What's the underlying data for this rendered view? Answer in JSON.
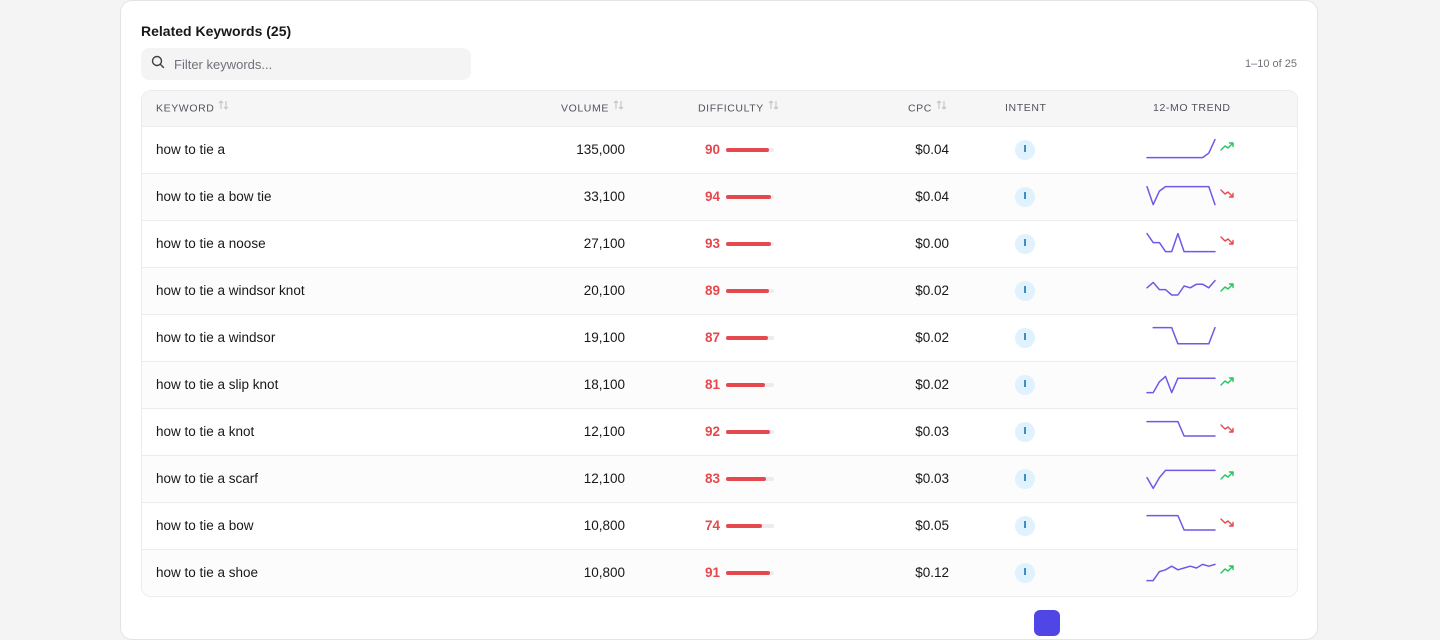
{
  "title": "Related Keywords (25)",
  "search": {
    "placeholder": "Filter keywords..."
  },
  "range_text": "1–10 of 25",
  "columns": {
    "keyword": "KEYWORD",
    "volume": "VOLUME",
    "difficulty": "DIFFICULTY",
    "cpc": "CPC",
    "intent": "INTENT",
    "trend": "12-MO TREND"
  },
  "colors": {
    "difficulty": "#e5484d",
    "sparkline": "#6d5ae6",
    "trend_up": "#22c55e",
    "trend_down": "#e5484d",
    "intent_bg": "#e0f2fe",
    "pager_active": "#4f46e5"
  },
  "rows": [
    {
      "keyword": "how to tie a",
      "volume": "135,000",
      "difficulty": "90",
      "cpc": "$0.04",
      "intent": "I",
      "trend_direction": "up",
      "trend": [
        40,
        40,
        40,
        40,
        40,
        40,
        40,
        40,
        40,
        40,
        35,
        20
      ]
    },
    {
      "keyword": "how to tie a bow tie",
      "volume": "33,100",
      "difficulty": "94",
      "cpc": "$0.04",
      "intent": "I",
      "trend_direction": "down",
      "trend": [
        20,
        40,
        25,
        20,
        20,
        20,
        20,
        20,
        20,
        20,
        20,
        40
      ]
    },
    {
      "keyword": "how to tie a noose",
      "volume": "27,100",
      "difficulty": "93",
      "cpc": "$0.00",
      "intent": "I",
      "trend_direction": "down",
      "trend": [
        20,
        30,
        30,
        40,
        40,
        20,
        40,
        40,
        40,
        40,
        40,
        40
      ]
    },
    {
      "keyword": "how to tie a windsor knot",
      "volume": "20,100",
      "difficulty": "89",
      "cpc": "$0.02",
      "intent": "I",
      "trend_direction": "up",
      "trend": [
        28,
        22,
        30,
        30,
        36,
        36,
        26,
        28,
        24,
        24,
        28,
        20
      ]
    },
    {
      "keyword": "how to tie a windsor",
      "volume": "19,100",
      "difficulty": "87",
      "cpc": "$0.02",
      "intent": "I",
      "trend_direction": "",
      "trend": [
        null,
        20,
        20,
        20,
        20,
        38,
        38,
        38,
        38,
        38,
        38,
        20
      ]
    },
    {
      "keyword": "how to tie a slip knot",
      "volume": "18,100",
      "difficulty": "81",
      "cpc": "$0.02",
      "intent": "I",
      "trend_direction": "up",
      "trend": [
        40,
        40,
        28,
        22,
        40,
        24,
        24,
        24,
        24,
        24,
        24,
        24
      ]
    },
    {
      "keyword": "how to tie a knot",
      "volume": "12,100",
      "difficulty": "92",
      "cpc": "$0.03",
      "intent": "I",
      "trend_direction": "down",
      "trend": [
        20,
        20,
        20,
        20,
        20,
        20,
        36,
        36,
        36,
        36,
        36,
        36
      ]
    },
    {
      "keyword": "how to tie a scarf",
      "volume": "12,100",
      "difficulty": "83",
      "cpc": "$0.03",
      "intent": "I",
      "trend_direction": "up",
      "trend": [
        30,
        42,
        30,
        22,
        22,
        22,
        22,
        22,
        22,
        22,
        22,
        22
      ]
    },
    {
      "keyword": "how to tie a bow",
      "volume": "10,800",
      "difficulty": "74",
      "cpc": "$0.05",
      "intent": "I",
      "trend_direction": "down",
      "trend": [
        20,
        20,
        20,
        20,
        20,
        20,
        36,
        36,
        36,
        36,
        36,
        36
      ]
    },
    {
      "keyword": "how to tie a shoe",
      "volume": "10,800",
      "difficulty": "91",
      "cpc": "$0.12",
      "intent": "I",
      "trend_direction": "up",
      "trend": [
        40,
        40,
        30,
        28,
        24,
        28,
        26,
        24,
        26,
        22,
        24,
        22
      ]
    }
  ]
}
